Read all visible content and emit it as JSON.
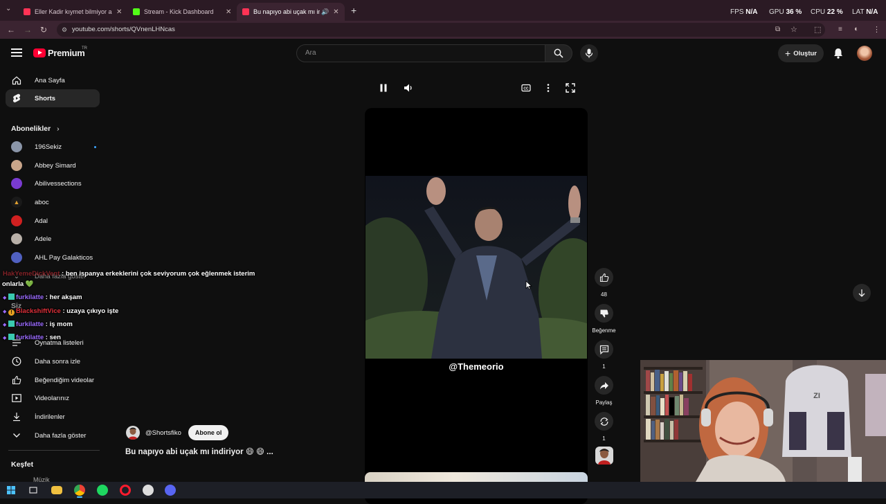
{
  "browser": {
    "tabs": [
      {
        "title": "Eller Kadir kıymet bilmiyor anne",
        "color": "#ff3355",
        "active": false
      },
      {
        "title": "Stream - Kick Dashboard",
        "color": "#53fc18",
        "active": false
      },
      {
        "title": "Bu napıyo abi uçak mı indiriyo",
        "color": "#ff3355",
        "active": true
      }
    ],
    "new_tab": "+",
    "stats": [
      {
        "label": "FPS",
        "value": "N/A"
      },
      {
        "label": "GPU",
        "value": "36 %"
      },
      {
        "label": "CPU",
        "value": "22 %"
      },
      {
        "label": "LAT",
        "value": "N/A"
      }
    ],
    "url": "youtube.com/shorts/QVnenLHNcas"
  },
  "youtube": {
    "logo_text": "Premium",
    "region": "TR",
    "search_placeholder": "Ara",
    "create_label": "Oluştur"
  },
  "sidebar": {
    "main": [
      {
        "label": "Ana Sayfa",
        "icon": "home-icon"
      },
      {
        "label": "Shorts",
        "icon": "shorts-icon",
        "selected": true
      }
    ],
    "subscriptions_header": "Abonelikler",
    "subscriptions": [
      {
        "label": "196Sekiz",
        "color": "#8a95a8",
        "live": true
      },
      {
        "label": "Abbey Simard",
        "color": "#c9a58a"
      },
      {
        "label": "Abilivessections",
        "color": "#7a3bd1"
      },
      {
        "label": "aboc",
        "color": "#e0a030"
      },
      {
        "label": "Adal",
        "color": "#d02020"
      },
      {
        "label": "Adele",
        "color": "#b8b0a8"
      },
      {
        "label": "AHL Pay Galakticos",
        "color": "#5060c0"
      }
    ],
    "show_more_subs": "Daha fazla göster",
    "you_header": "Siz",
    "you_items": [
      {
        "label": "Oynatma listeleri",
        "icon": "playlist-icon"
      },
      {
        "label": "Daha sonra izle",
        "icon": "clock-icon"
      },
      {
        "label": "Beğendiğim videolar",
        "icon": "thumbs-up-icon"
      },
      {
        "label": "Videolarınız",
        "icon": "video-icon"
      },
      {
        "label": "İndirilenler",
        "icon": "download-icon"
      },
      {
        "label": "Daha fazla göster",
        "icon": "chevron-down-icon"
      }
    ],
    "explore_header": "Keşfet",
    "explore_first": "Müzik"
  },
  "chat": [
    {
      "user": "HakYemeDickVent",
      "text": " : ben ispanya erkeklerini çok seviyorum çok eğlenmek isterim",
      "color": "#e0303a"
    },
    {
      "user": "",
      "text": "onlarla 💚",
      "color": "#fff"
    },
    {
      "user": "furkilatte",
      "text": " : her akşam",
      "color": "#9b6bff"
    },
    {
      "user": "BlackshiftVice",
      "text": " : uzaya çıkıyo işte",
      "color": "#e0303a"
    },
    {
      "user": "furkilatte",
      "text": " : iş mom",
      "color": "#9b6bff"
    },
    {
      "user": "furkilatte",
      "text": " : sen",
      "color": "#9b6bff"
    }
  ],
  "short": {
    "handle": "@Themeorio",
    "channel": "@Shortsfiko",
    "subscribe_label": "Abone ol",
    "title": "Bu napıyo abi uçak mı indiriyor 😄 😄 ..."
  },
  "actions": {
    "likes": "48",
    "dislike_label": "Beğenme",
    "comments": "1",
    "share_label": "Paylaş",
    "remix": "1"
  }
}
